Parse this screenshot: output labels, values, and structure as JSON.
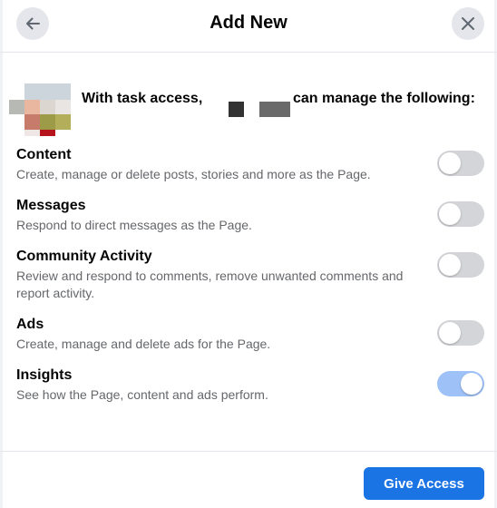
{
  "header": {
    "title": "Add New",
    "back_icon": "arrow-left-icon",
    "close_icon": "close-icon"
  },
  "intro": {
    "prefix": "With task access,",
    "suffix": "can manage the following:"
  },
  "permissions": [
    {
      "title": "Content",
      "description": "Create, manage or delete posts, stories and more as the Page.",
      "enabled": false
    },
    {
      "title": "Messages",
      "description": "Respond to direct messages as the Page.",
      "enabled": false
    },
    {
      "title": "Community Activity",
      "description": "Review and respond to comments, remove unwanted comments and report activity.",
      "enabled": false
    },
    {
      "title": "Ads",
      "description": "Create, manage and delete ads for the Page.",
      "enabled": false
    },
    {
      "title": "Insights",
      "description": "See how the Page, content and ads perform.",
      "enabled": true
    }
  ],
  "footer": {
    "give_access_label": "Give Access"
  },
  "colors": {
    "primary": "#1b74e4",
    "toggle_on": "#9ec1f7",
    "toggle_off": "#d3d5d9"
  }
}
